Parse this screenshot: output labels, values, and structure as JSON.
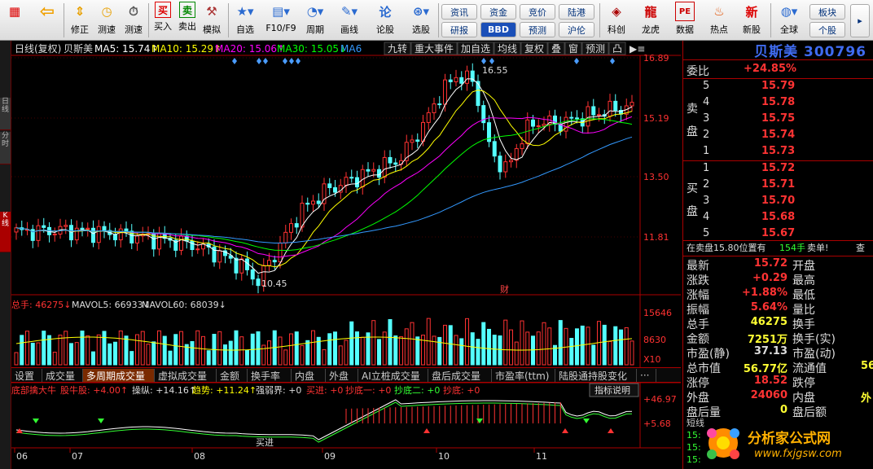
{
  "toolbar": {
    "buttons": [
      {
        "label": "",
        "icon": "grid-icon"
      },
      {
        "label": "",
        "icon": "back-arrow-icon"
      },
      {
        "label": "修正",
        "icon": "up-down-arrows-icon"
      },
      {
        "label": "测速",
        "icon": "clock-icon"
      },
      {
        "label": "买入",
        "icon": "buy-icon"
      },
      {
        "label": "卖出",
        "icon": "sell-icon"
      },
      {
        "label": "模拟",
        "icon": "hammer-icon"
      },
      {
        "label": "自选",
        "icon": "star-board-icon"
      },
      {
        "label": "F10/F9",
        "icon": "f10-icon"
      },
      {
        "label": "周期",
        "icon": "period-clock-icon"
      },
      {
        "label": "画线",
        "icon": "pencil-icon"
      },
      {
        "label": "论股",
        "icon": "discuss-icon"
      },
      {
        "label": "选股",
        "icon": "select-stock-icon"
      },
      {
        "label": "科创",
        "icon": "kechuang-icon"
      },
      {
        "label": "龙虎",
        "icon": "dragon-tiger-icon"
      },
      {
        "label": "数据",
        "icon": "pe-data-icon"
      },
      {
        "label": "热点",
        "icon": "hot-icon"
      },
      {
        "label": "新股",
        "icon": "new-stock-icon"
      },
      {
        "label": "全球",
        "icon": "globe-icon"
      }
    ],
    "pills": [
      "资讯",
      "资金",
      "竞价",
      "陆港",
      "研报",
      "BBD",
      "预测",
      "沪伦",
      "板块",
      "个股"
    ]
  },
  "left_tabs": [
    "日线",
    "分时",
    "K线"
  ],
  "main_chart": {
    "header": {
      "period": "日线(复权)",
      "stock": "贝斯美",
      "ma5": "MA5: 15.74↑",
      "ma10": "MA10: 15.29↑",
      "ma20": "MA20: 15.06↑",
      "ma30": "MA30: 15.05↓",
      "ma6x": "MA6"
    },
    "tools": [
      "九转",
      "重大事件",
      "加自选",
      "均线",
      "复权",
      "叠",
      "窗",
      "预测",
      "凸"
    ],
    "price_ticks": [
      "16.89",
      "15.19",
      "13.50",
      "11.81"
    ],
    "high_label": "16.55",
    "low_label": "10.45",
    "marker_cai": "财",
    "series_colors": {
      "up": "#ff3232",
      "down": "#54ffff",
      "ma5": "#ffffff",
      "ma10": "#ffff00",
      "ma20": "#ff00ff",
      "ma30": "#00ff00",
      "ma60": "#3399ff"
    }
  },
  "volume": {
    "label_total": "总手: 46275↓",
    "label_mavol5": "MAVOL5: 66933↓",
    "label_mavol60": "MAVOL60: 68039↓",
    "ticks": [
      "15646",
      "8630"
    ],
    "unit": "X10"
  },
  "bottom_tabs": [
    "设置",
    "成交量",
    "多周期成交量",
    "虚拟成交量",
    "金额",
    "换手率",
    "内盘",
    "外盘",
    "AI立桩成交量",
    "盘后成交量",
    "市盈率(ttm)",
    "陆股通持股变化",
    "···"
  ],
  "indicator": {
    "title": "底部擒大牛",
    "mania": "股牛股: +4.00↑",
    "cao": "操纵: +14.16↑",
    "trend": "趋势: +11.24↑",
    "strong": "强弱界: +0",
    "buy": "买进: +0",
    "bottom1": "抄底一: +0",
    "bottom2": "抄底二: +0",
    "bottom": "抄底: +0",
    "explain": "指标说明",
    "ticks": [
      "+46.97",
      "+5.68"
    ],
    "label_entry": "买进"
  },
  "x_axis": [
    "06",
    "07",
    "08",
    "09",
    "10",
    "11"
  ],
  "quote": {
    "name_code": "贝斯美 300796",
    "weibi_label": "委比",
    "weibi_value": "+24.85%",
    "sell_label": "卖盘",
    "buy_label": "买盘",
    "asks": [
      {
        "lvl": "5",
        "price": "15.79"
      },
      {
        "lvl": "4",
        "price": "15.78"
      },
      {
        "lvl": "3",
        "price": "15.75"
      },
      {
        "lvl": "2",
        "price": "15.74"
      },
      {
        "lvl": "1",
        "price": "15.73"
      }
    ],
    "bids": [
      {
        "lvl": "1",
        "price": "15.72"
      },
      {
        "lvl": "2",
        "price": "15.71"
      },
      {
        "lvl": "3",
        "price": "15.70"
      },
      {
        "lvl": "4",
        "price": "15.68"
      },
      {
        "lvl": "5",
        "price": "15.67"
      }
    ],
    "notice": "在卖盘15.80位置有",
    "notice_qty": "154手",
    "notice_tail": "卖单!",
    "notice_btn": "查",
    "stats": [
      {
        "l": "最新",
        "v": "15.72",
        "r": "开盘"
      },
      {
        "l": "涨跌",
        "v": "+0.29",
        "r": "最高"
      },
      {
        "l": "涨幅",
        "v": "+1.88%",
        "r": "最低"
      },
      {
        "l": "振幅",
        "v": "5.64%",
        "r": "量比"
      },
      {
        "l": "总手",
        "v": "46275",
        "r": "换手"
      },
      {
        "l": "金额",
        "v": "7251万",
        "r": "换手(实)"
      },
      {
        "l": "市盈(静)",
        "v": "37.13",
        "r": "市盈(动)"
      },
      {
        "l": "总市值",
        "v": "56.77亿",
        "r": "流通值"
      },
      {
        "l": "涨停",
        "v": "18.52",
        "r": "跌停"
      },
      {
        "l": "外盘",
        "v": "24060",
        "r": "内盘"
      },
      {
        "l": "盘后量",
        "v": "0",
        "r": "盘后额"
      }
    ],
    "stats_right_vals": [
      "",
      "",
      "",
      "",
      "",
      "",
      "",
      "56",
      "",
      "外",
      ""
    ],
    "bottom_labels": [
      "短线",
      "15:",
      "15:",
      "15:"
    ]
  },
  "watermark": {
    "brand": "分析家公式网",
    "url": "www.fxjgsw.com"
  }
}
